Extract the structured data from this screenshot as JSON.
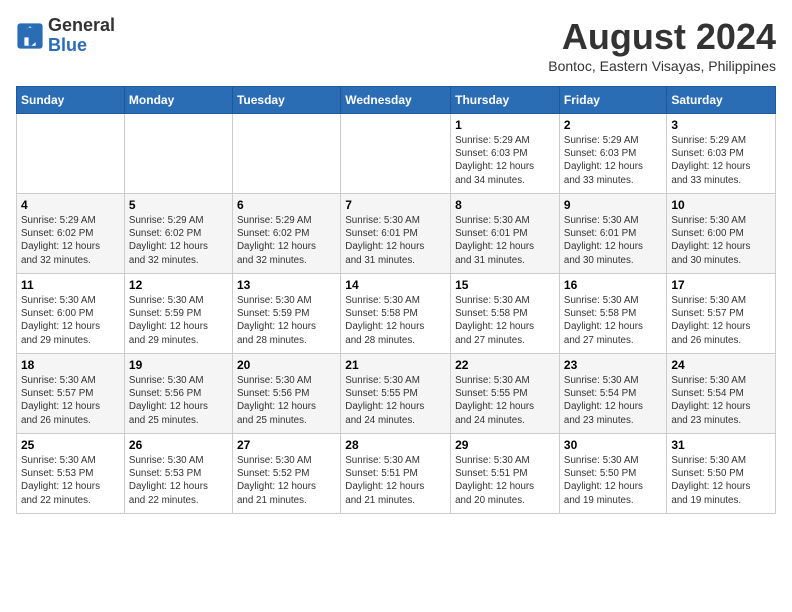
{
  "logo": {
    "line1": "General",
    "line2": "Blue"
  },
  "title": "August 2024",
  "subtitle": "Bontoc, Eastern Visayas, Philippines",
  "days_of_week": [
    "Sunday",
    "Monday",
    "Tuesday",
    "Wednesday",
    "Thursday",
    "Friday",
    "Saturday"
  ],
  "weeks": [
    [
      {
        "day": "",
        "info": ""
      },
      {
        "day": "",
        "info": ""
      },
      {
        "day": "",
        "info": ""
      },
      {
        "day": "",
        "info": ""
      },
      {
        "day": "1",
        "info": "Sunrise: 5:29 AM\nSunset: 6:03 PM\nDaylight: 12 hours\nand 34 minutes."
      },
      {
        "day": "2",
        "info": "Sunrise: 5:29 AM\nSunset: 6:03 PM\nDaylight: 12 hours\nand 33 minutes."
      },
      {
        "day": "3",
        "info": "Sunrise: 5:29 AM\nSunset: 6:03 PM\nDaylight: 12 hours\nand 33 minutes."
      }
    ],
    [
      {
        "day": "4",
        "info": "Sunrise: 5:29 AM\nSunset: 6:02 PM\nDaylight: 12 hours\nand 32 minutes."
      },
      {
        "day": "5",
        "info": "Sunrise: 5:29 AM\nSunset: 6:02 PM\nDaylight: 12 hours\nand 32 minutes."
      },
      {
        "day": "6",
        "info": "Sunrise: 5:29 AM\nSunset: 6:02 PM\nDaylight: 12 hours\nand 32 minutes."
      },
      {
        "day": "7",
        "info": "Sunrise: 5:30 AM\nSunset: 6:01 PM\nDaylight: 12 hours\nand 31 minutes."
      },
      {
        "day": "8",
        "info": "Sunrise: 5:30 AM\nSunset: 6:01 PM\nDaylight: 12 hours\nand 31 minutes."
      },
      {
        "day": "9",
        "info": "Sunrise: 5:30 AM\nSunset: 6:01 PM\nDaylight: 12 hours\nand 30 minutes."
      },
      {
        "day": "10",
        "info": "Sunrise: 5:30 AM\nSunset: 6:00 PM\nDaylight: 12 hours\nand 30 minutes."
      }
    ],
    [
      {
        "day": "11",
        "info": "Sunrise: 5:30 AM\nSunset: 6:00 PM\nDaylight: 12 hours\nand 29 minutes."
      },
      {
        "day": "12",
        "info": "Sunrise: 5:30 AM\nSunset: 5:59 PM\nDaylight: 12 hours\nand 29 minutes."
      },
      {
        "day": "13",
        "info": "Sunrise: 5:30 AM\nSunset: 5:59 PM\nDaylight: 12 hours\nand 28 minutes."
      },
      {
        "day": "14",
        "info": "Sunrise: 5:30 AM\nSunset: 5:58 PM\nDaylight: 12 hours\nand 28 minutes."
      },
      {
        "day": "15",
        "info": "Sunrise: 5:30 AM\nSunset: 5:58 PM\nDaylight: 12 hours\nand 27 minutes."
      },
      {
        "day": "16",
        "info": "Sunrise: 5:30 AM\nSunset: 5:58 PM\nDaylight: 12 hours\nand 27 minutes."
      },
      {
        "day": "17",
        "info": "Sunrise: 5:30 AM\nSunset: 5:57 PM\nDaylight: 12 hours\nand 26 minutes."
      }
    ],
    [
      {
        "day": "18",
        "info": "Sunrise: 5:30 AM\nSunset: 5:57 PM\nDaylight: 12 hours\nand 26 minutes."
      },
      {
        "day": "19",
        "info": "Sunrise: 5:30 AM\nSunset: 5:56 PM\nDaylight: 12 hours\nand 25 minutes."
      },
      {
        "day": "20",
        "info": "Sunrise: 5:30 AM\nSunset: 5:56 PM\nDaylight: 12 hours\nand 25 minutes."
      },
      {
        "day": "21",
        "info": "Sunrise: 5:30 AM\nSunset: 5:55 PM\nDaylight: 12 hours\nand 24 minutes."
      },
      {
        "day": "22",
        "info": "Sunrise: 5:30 AM\nSunset: 5:55 PM\nDaylight: 12 hours\nand 24 minutes."
      },
      {
        "day": "23",
        "info": "Sunrise: 5:30 AM\nSunset: 5:54 PM\nDaylight: 12 hours\nand 23 minutes."
      },
      {
        "day": "24",
        "info": "Sunrise: 5:30 AM\nSunset: 5:54 PM\nDaylight: 12 hours\nand 23 minutes."
      }
    ],
    [
      {
        "day": "25",
        "info": "Sunrise: 5:30 AM\nSunset: 5:53 PM\nDaylight: 12 hours\nand 22 minutes."
      },
      {
        "day": "26",
        "info": "Sunrise: 5:30 AM\nSunset: 5:53 PM\nDaylight: 12 hours\nand 22 minutes."
      },
      {
        "day": "27",
        "info": "Sunrise: 5:30 AM\nSunset: 5:52 PM\nDaylight: 12 hours\nand 21 minutes."
      },
      {
        "day": "28",
        "info": "Sunrise: 5:30 AM\nSunset: 5:51 PM\nDaylight: 12 hours\nand 21 minutes."
      },
      {
        "day": "29",
        "info": "Sunrise: 5:30 AM\nSunset: 5:51 PM\nDaylight: 12 hours\nand 20 minutes."
      },
      {
        "day": "30",
        "info": "Sunrise: 5:30 AM\nSunset: 5:50 PM\nDaylight: 12 hours\nand 19 minutes."
      },
      {
        "day": "31",
        "info": "Sunrise: 5:30 AM\nSunset: 5:50 PM\nDaylight: 12 hours\nand 19 minutes."
      }
    ]
  ]
}
